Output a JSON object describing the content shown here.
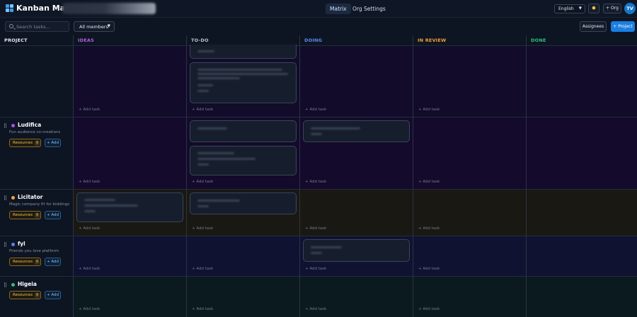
{
  "app": {
    "brand": "Kanban Matrix",
    "user_initials": "TV"
  },
  "nav": {
    "matrix": "Matrix",
    "org_settings": "Org Settings"
  },
  "header_actions": {
    "language": "English",
    "org_button": "+ Org"
  },
  "toolbar": {
    "search_placeholder": "Search tasks...",
    "members_filter": "All members",
    "assignees_button": "Assignees",
    "project_button": "+ Project"
  },
  "columns": [
    {
      "label": "PROJECT",
      "color": "#e6e9f0"
    },
    {
      "label": "IDEAS",
      "color": "#b25ee6"
    },
    {
      "label": "TO-DO",
      "color": "#b9c1cf"
    },
    {
      "label": "DOING",
      "color": "#5b8ef0"
    },
    {
      "label": "IN REVIEW",
      "color": "#f0a13a"
    },
    {
      "label": "DONE",
      "color": "#34c07a"
    }
  ],
  "board": {
    "add_task_label": "+ Add task"
  },
  "projects": [
    {
      "name": "Ludifica",
      "description": "Fun audience co-creations",
      "dot_color": "#b04de8",
      "resources_label": "Resources",
      "resources_count": "0",
      "add_label": "+ Add"
    },
    {
      "name": "Licitator",
      "description": "Magic company fit for biddings",
      "dot_color": "#f2a43c",
      "resources_label": "Resources",
      "resources_count": "0",
      "add_label": "+ Add"
    },
    {
      "name": "fyl",
      "description": "Friends you love platform",
      "dot_color": "#5b7ff0",
      "resources_label": "Resources",
      "resources_count": "0",
      "add_label": "+ Add"
    },
    {
      "name": "Higeia",
      "description": "",
      "dot_color": "#2fc07a",
      "resources_label": "Resources",
      "resources_count": "0",
      "add_label": "+ Add"
    }
  ],
  "colors": {
    "background": "#0d1422",
    "accent": "#1a7fe0",
    "resources_border": "#8a6a1e"
  }
}
